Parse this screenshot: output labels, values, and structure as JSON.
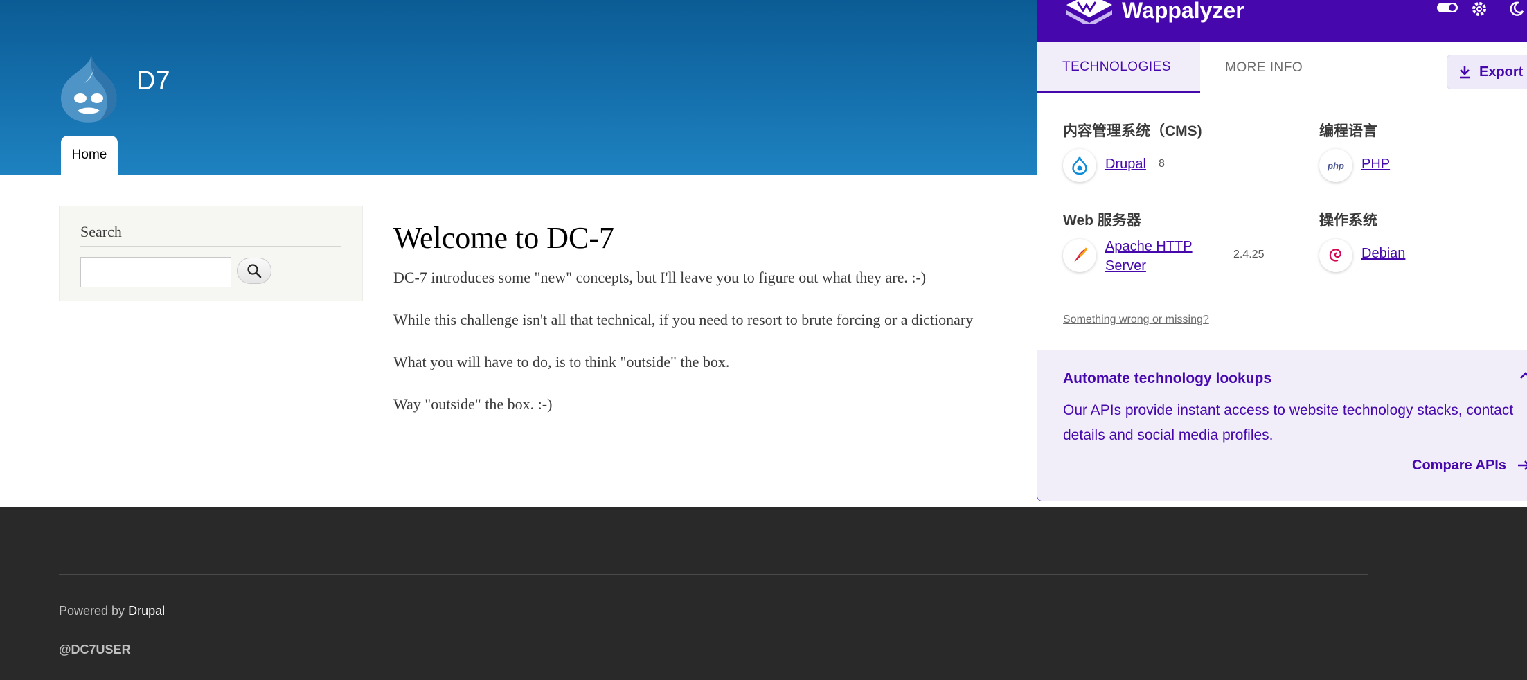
{
  "site": {
    "name": "D7",
    "nav": {
      "home": "Home"
    },
    "search_block": {
      "title": "Search",
      "input_value": ""
    },
    "content": {
      "title": "Welcome to DC-7",
      "paragraphs": [
        "DC-7 introduces some \"new\" concepts, but I'll leave you to figure out what they are.  :-)",
        "While this challenge isn't all that technical, if you need to resort to brute forcing or a dictionary",
        "What you will have to do, is to think \"outside\" the box.",
        "Way \"outside\" the box.  :-)"
      ]
    },
    "footer": {
      "powered_prefix": "Powered by",
      "powered_link": "Drupal",
      "handle": "@DC7USER"
    }
  },
  "wappalyzer": {
    "brand": "Wappalyzer",
    "tabs": {
      "technologies": "TECHNOLOGIES",
      "more_info": "MORE INFO"
    },
    "export_label": "Export",
    "categories": {
      "cms": {
        "title": "内容管理系统（CMS)",
        "tech": "Drupal",
        "version": "8",
        "icon": "drupal-icon"
      },
      "lang": {
        "title": "编程语言",
        "tech": "PHP",
        "icon": "php-icon"
      },
      "web": {
        "title": "Web 服务器",
        "tech_line1": "Apache HTTP",
        "tech_line2": "Server",
        "version": "2.4.25",
        "icon": "apache-icon"
      },
      "os": {
        "title": "操作系统",
        "tech": "Debian",
        "icon": "debian-icon"
      }
    },
    "wrong_link": "Something wrong or missing?",
    "promo": {
      "title": "Automate technology lookups",
      "text": "Our APIs provide instant access to website technology stacks, contact details and social media profiles.",
      "link": "Compare APIs"
    },
    "colors": {
      "accent": "#4608ad",
      "header_bg": "#4608ad",
      "promo_bg": "#f1eefa"
    }
  }
}
